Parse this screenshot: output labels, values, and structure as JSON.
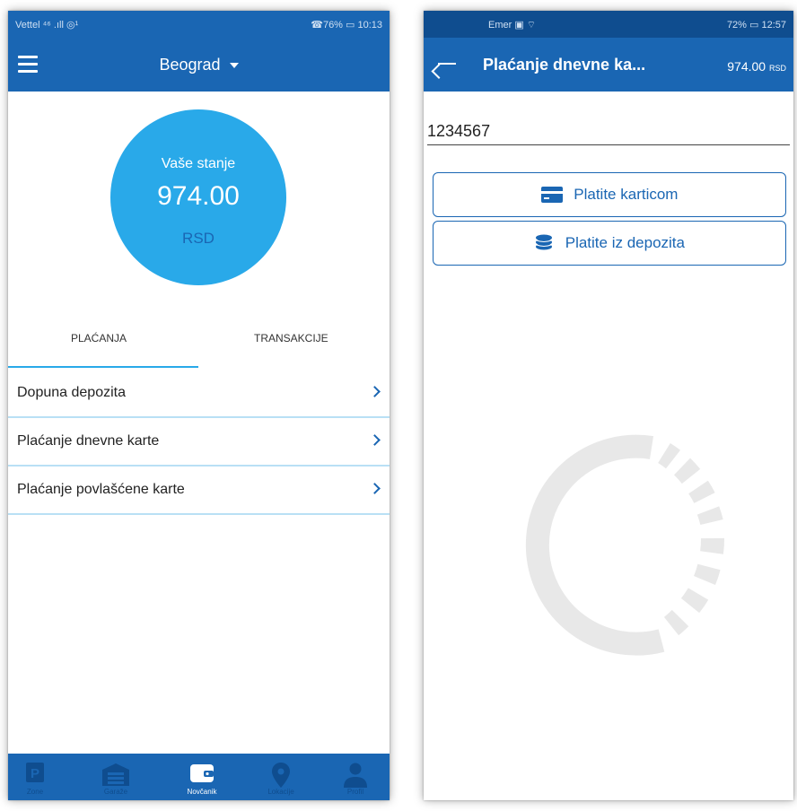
{
  "left": {
    "status": {
      "left": "Vettel ⁴⁶ .ıll ◎¹",
      "right": "☎76% ▭ 10:13"
    },
    "header": {
      "city": "Beograd"
    },
    "balance": {
      "label": "Vaše stanje",
      "amount": "974.00",
      "currency": "RSD"
    },
    "tabs": [
      "PLAĆANJA",
      "TRANSAKCIJE"
    ],
    "list": [
      "Dopuna depozita",
      "Plaćanje dnevne karte",
      "Plaćanje povlašćene karte"
    ],
    "bottom_nav": [
      "Zone",
      "Garaže",
      "Novčanik",
      "Lokacije",
      "Profil"
    ],
    "active_nav": "Novčanik"
  },
  "right": {
    "status": {
      "left": "Emer ▣ ⌔",
      "right": "72% ▭ 12:57"
    },
    "header": {
      "title": "Plaćanje dnevne ka...",
      "amount": "974.00",
      "currency": "RSD"
    },
    "ticket_number": "1234567",
    "buttons": {
      "card": "Platite karticom",
      "deposit": "Platite iz depozita"
    }
  },
  "colors": {
    "primary": "#1a66b3",
    "accent": "#29a9e9"
  },
  "icons": [
    "menu-icon",
    "dropdown-caret-icon",
    "chevron-right-icon",
    "parking-icon",
    "garage-icon",
    "wallet-icon",
    "location-pin-icon",
    "user-icon",
    "back-arrow-icon",
    "credit-card-icon",
    "coins-icon",
    "loading-spinner-icon"
  ]
}
